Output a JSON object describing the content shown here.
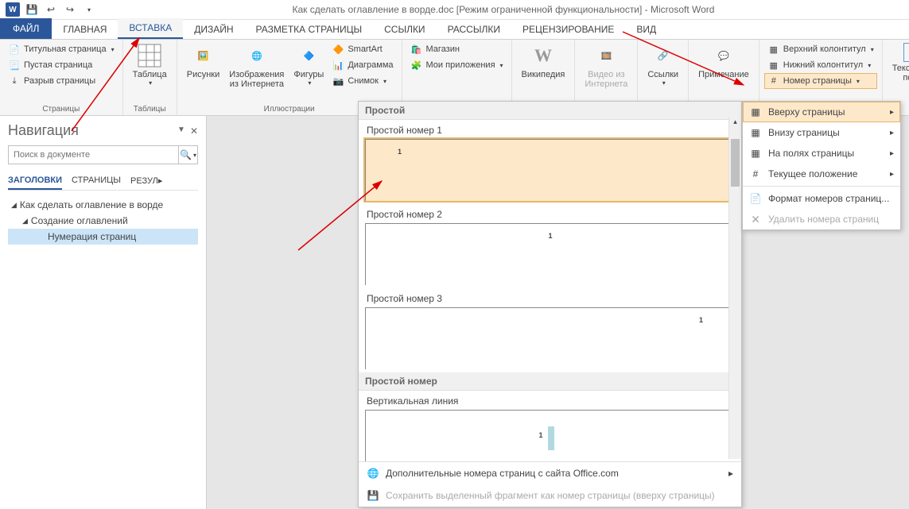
{
  "title": "Как сделать оглавление в ворде.doc [Режим ограниченной функциональности] - Microsoft Word",
  "tabs": {
    "file": "ФАЙЛ",
    "home": "ГЛАВНАЯ",
    "insert": "ВСТАВКА",
    "design": "ДИЗАЙН",
    "layout": "РАЗМЕТКА СТРАНИЦЫ",
    "references": "ССЫЛКИ",
    "mailings": "РАССЫЛКИ",
    "review": "РЕЦЕНЗИРОВАНИЕ",
    "view": "ВИД"
  },
  "ribbon": {
    "pages": {
      "cover": "Титульная страница",
      "blank": "Пустая страница",
      "break": "Разрыв страницы",
      "label": "Страницы"
    },
    "tables": {
      "table": "Таблица",
      "label": "Таблицы"
    },
    "illustrations": {
      "pictures": "Рисунки",
      "online_pictures": "Изображения из Интернета",
      "shapes": "Фигуры",
      "smartart": "SmartArt",
      "chart": "Диаграмма",
      "screenshot": "Снимок",
      "label": "Иллюстрации"
    },
    "apps": {
      "store": "Магазин",
      "myapps": "Мои приложения"
    },
    "media": {
      "wikipedia": "Википедия",
      "video": "Видео из Интернета"
    },
    "links": {
      "links": "Ссылки"
    },
    "comments": {
      "comment": "Примечание"
    },
    "headerfooter": {
      "header": "Верхний колонтитул",
      "footer": "Нижний колонтитул",
      "pagenum": "Номер страницы"
    },
    "text": {
      "textbox": "Текстовое поле"
    }
  },
  "pagenum_menu": {
    "top": "Вверху страницы",
    "bottom": "Внизу страницы",
    "margins": "На полях страницы",
    "current": "Текущее положение",
    "format": "Формат номеров страниц...",
    "remove": "Удалить номера страниц"
  },
  "gallery": {
    "section1": "Простой",
    "item1": "Простой номер 1",
    "item2": "Простой номер 2",
    "item3": "Простой номер 3",
    "section2": "Простой номер",
    "item4": "Вертикальная линия",
    "more": "Дополнительные номера страниц с сайта Office.com",
    "save": "Сохранить выделенный фрагмент как номер страницы (вверху страницы)"
  },
  "nav": {
    "title": "Навигация",
    "search_placeholder": "Поиск в документе",
    "tab_headings": "ЗАГОЛОВКИ",
    "tab_pages": "СТРАНИЦЫ",
    "tab_results": "РЕЗУЛ",
    "outline": {
      "l1": "Как сделать оглавление в ворде",
      "l2": "Создание оглавлений",
      "l3": "Нумерация страниц"
    }
  }
}
